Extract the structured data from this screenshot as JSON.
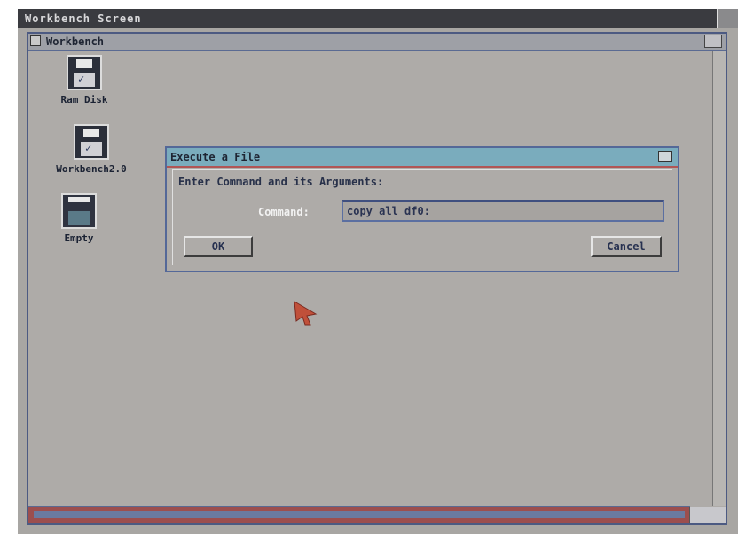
{
  "screen": {
    "title": "Workbench Screen"
  },
  "workbench_window": {
    "title": "Workbench"
  },
  "desktop_icons": [
    {
      "label": "Ram Disk",
      "icon": "floppy-disk-icon"
    },
    {
      "label": "Workbench2.0",
      "icon": "floppy-disk-icon"
    },
    {
      "label": "Empty",
      "icon": "trashcan-icon"
    }
  ],
  "dialog": {
    "title": "Execute a File",
    "prompt": "Enter Command and its Arguments:",
    "command_label": "Command:",
    "command_value": "copy all df0:",
    "ok_label": "OK",
    "cancel_label": "Cancel"
  },
  "colors": {
    "screen_bg": "#a8a6a3",
    "title_dark": "#3a3b40",
    "dialog_title_bg": "#7aacbd",
    "border_blue": "#546898",
    "accent_red": "#b15555",
    "pointer": "#c0503a"
  }
}
